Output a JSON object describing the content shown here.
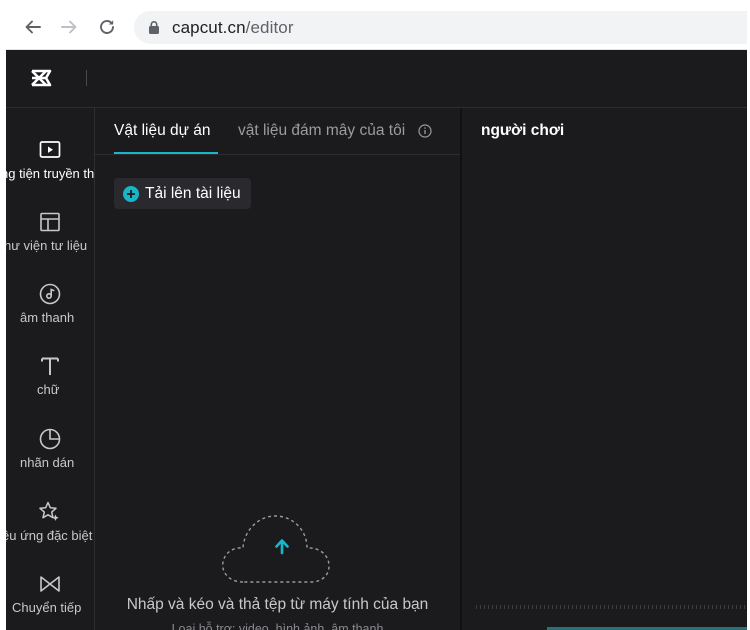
{
  "browser": {
    "url_host": "capcut.cn",
    "url_path": "/editor"
  },
  "app": {
    "logo": "capcut-logo"
  },
  "rail": {
    "items": [
      {
        "label": "ng tiện truyền thông",
        "icon": "media-icon"
      },
      {
        "label": "hư viện tư liệu",
        "icon": "library-icon"
      },
      {
        "label": "âm thanh",
        "icon": "audio-icon"
      },
      {
        "label": "chữ",
        "icon": "text-icon"
      },
      {
        "label": "nhãn dán",
        "icon": "sticker-icon"
      },
      {
        "label": "ệu ứng đặc biệt",
        "icon": "effects-icon"
      },
      {
        "label": "Chuyển tiếp",
        "icon": "transition-icon"
      }
    ]
  },
  "media_panel": {
    "tabs": [
      {
        "label": "Vật liệu dự án",
        "active": true
      },
      {
        "label": "vật liệu đám mây của tôi",
        "active": false
      }
    ],
    "upload_label": "Tải lên tài liệu",
    "drop_text": "Nhấp và kéo và thả tệp từ máy tính của bạn",
    "drop_subtext": "Loại hỗ trợ: video, hình ảnh, âm thanh"
  },
  "player": {
    "title": "người chơi"
  },
  "colors": {
    "accent": "#19b6c9",
    "background": "#1b1b1d"
  }
}
